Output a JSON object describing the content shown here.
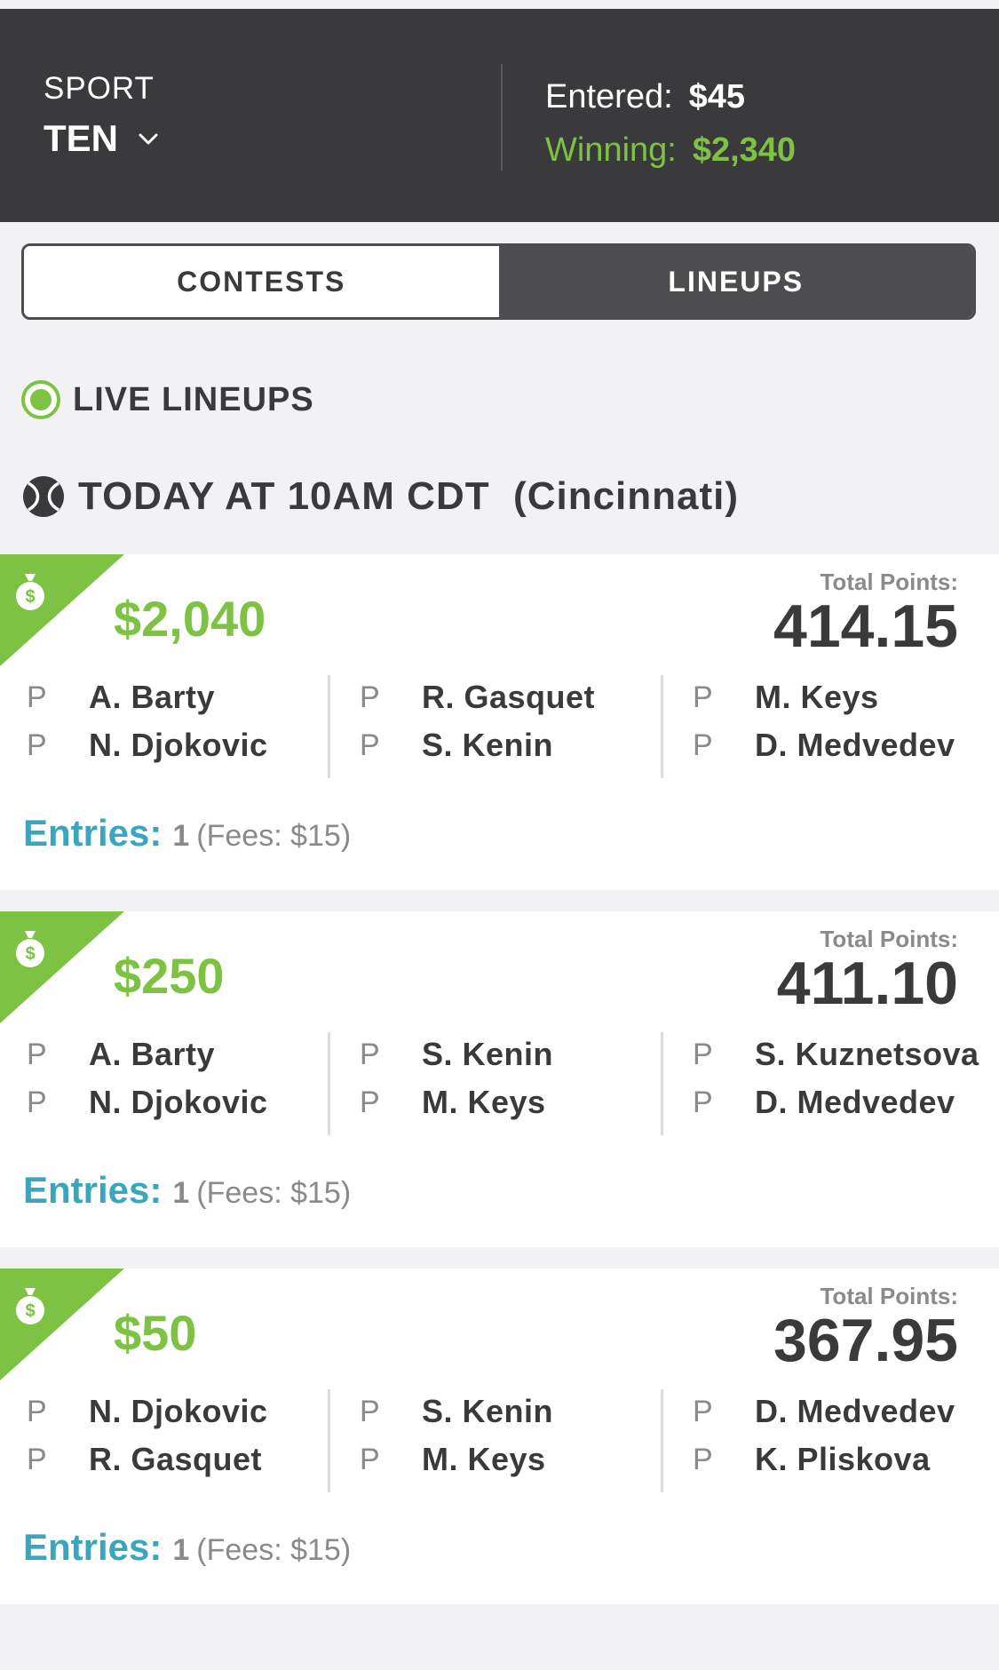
{
  "header": {
    "sport_label": "SPORT",
    "sport_value": "TEN",
    "entered_label": "Entered:",
    "entered_value": "$45",
    "winning_label": "Winning:",
    "winning_value": "$2,340"
  },
  "tabs": [
    {
      "label": "CONTESTS",
      "selected": false
    },
    {
      "label": "LINEUPS",
      "selected": true
    }
  ],
  "live_label": "LIVE LINEUPS",
  "date_label": "TODAY AT 10AM CDT  (Cincinnati)",
  "total_points_label": "Total Points:",
  "entries_label": "Entries:",
  "lineups": [
    {
      "prize": "$2,040",
      "total_points": "414.15",
      "entries": "1",
      "fees": "(Fees: $15)",
      "players": [
        {
          "pos": "P",
          "name": "A. Barty"
        },
        {
          "pos": "P",
          "name": "N. Djokovic"
        },
        {
          "pos": "P",
          "name": "R. Gasquet"
        },
        {
          "pos": "P",
          "name": "S. Kenin"
        },
        {
          "pos": "P",
          "name": "M. Keys"
        },
        {
          "pos": "P",
          "name": "D. Medvedev"
        }
      ]
    },
    {
      "prize": "$250",
      "total_points": "411.10",
      "entries": "1",
      "fees": "(Fees: $15)",
      "players": [
        {
          "pos": "P",
          "name": "A. Barty"
        },
        {
          "pos": "P",
          "name": "N. Djokovic"
        },
        {
          "pos": "P",
          "name": "S. Kenin"
        },
        {
          "pos": "P",
          "name": "M. Keys"
        },
        {
          "pos": "P",
          "name": "S. Kuznetsova"
        },
        {
          "pos": "P",
          "name": "D. Medvedev"
        }
      ]
    },
    {
      "prize": "$50",
      "total_points": "367.95",
      "entries": "1",
      "fees": "(Fees: $15)",
      "players": [
        {
          "pos": "P",
          "name": "N. Djokovic"
        },
        {
          "pos": "P",
          "name": "R. Gasquet"
        },
        {
          "pos": "P",
          "name": "S. Kenin"
        },
        {
          "pos": "P",
          "name": "M. Keys"
        },
        {
          "pos": "P",
          "name": "D. Medvedev"
        },
        {
          "pos": "P",
          "name": "K. Pliskova"
        }
      ]
    }
  ],
  "colors": {
    "header_bg": "#3a3a3d",
    "accent_green": "#7dc242",
    "entries_teal": "#3aa6bd",
    "text_dark": "#3a3a3d",
    "text_muted": "#8a8a8d"
  }
}
